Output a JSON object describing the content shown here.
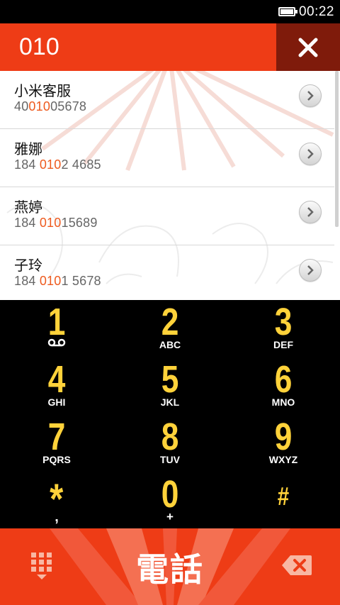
{
  "status_bar": {
    "time": "00:22",
    "battery_icon": "battery-icon"
  },
  "search": {
    "query": "010",
    "clear_icon": "close-icon"
  },
  "results": [
    {
      "name": "小米客服",
      "number_pre": "40",
      "number_match": "010",
      "number_post": "05678"
    },
    {
      "name": "雅娜",
      "number_pre": "184 ",
      "number_match": "010",
      "number_post": "2 4685"
    },
    {
      "name": "燕婷",
      "number_pre": "184 ",
      "number_match": "010",
      "number_post": "15689"
    },
    {
      "name": "子玲",
      "number_pre": "184 ",
      "number_match": "010",
      "number_post": "1 5678"
    }
  ],
  "keypad": [
    {
      "digit": "1",
      "letters": "",
      "icon": "voicemail-icon"
    },
    {
      "digit": "2",
      "letters": "ABC"
    },
    {
      "digit": "3",
      "letters": "DEF"
    },
    {
      "digit": "4",
      "letters": "GHI"
    },
    {
      "digit": "5",
      "letters": "JKL"
    },
    {
      "digit": "6",
      "letters": "MNO"
    },
    {
      "digit": "7",
      "letters": "PQRS"
    },
    {
      "digit": "8",
      "letters": "TUV"
    },
    {
      "digit": "9",
      "letters": "WXYZ"
    },
    {
      "digit": "*",
      "letters": ","
    },
    {
      "digit": "0",
      "letters": "+"
    },
    {
      "digit": "#",
      "letters": ""
    }
  ],
  "call_bar": {
    "call_label": "電話",
    "dialpad_icon": "dialpad-icon",
    "backspace_icon": "backspace-icon"
  },
  "colors": {
    "accent": "#ee3c16",
    "accent_dark": "#7f1b0b",
    "digit": "#ffd23a",
    "match": "#ee5a1e"
  }
}
